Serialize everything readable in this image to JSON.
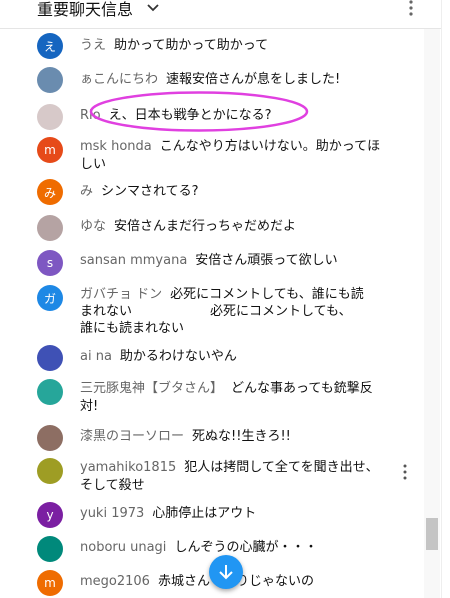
{
  "header": {
    "title": "重要聊天信息",
    "menu_icon": "chevron-down-icon",
    "more_icon": "more-vert-icon"
  },
  "colors": {
    "accent": "#2196f3",
    "annotation": "#e040e0"
  },
  "messages": [
    {
      "author": "うえ",
      "text": "助かって助かって助かって",
      "avatar": {
        "letter": "え",
        "color": "#1565c0"
      }
    },
    {
      "author": "ぁこんにちわ",
      "text": "速報安倍さんが息をしました!",
      "avatar": {
        "letter": "",
        "color": "#6a8caf"
      }
    },
    {
      "author": "Rio",
      "text": "え、日本も戦争とかになる?",
      "avatar": {
        "letter": "",
        "color": "#d7c9c9"
      }
    },
    {
      "author": "msk honda",
      "text": "こんなやり方はいけない。助かってほしい",
      "line1": "こんなやり方はいけない。助かってほ",
      "line2": "しい",
      "avatar": {
        "letter": "m",
        "color": "#e64a19"
      }
    },
    {
      "author": "み",
      "text": "シンマされてる?",
      "avatar": {
        "letter": "み",
        "color": "#ef6c00"
      }
    },
    {
      "author": "ゆな",
      "text": "安倍さんまだ行っちゃだめだよ",
      "avatar": {
        "letter": "",
        "color": "#b5a3a3"
      }
    },
    {
      "author": "sansan mmyana",
      "text": "安倍さん頑張って欲しい",
      "avatar": {
        "letter": "s",
        "color": "#7e57c2"
      }
    },
    {
      "author": "ガバチョ ドン",
      "line1": "必死にコメントしても、誰にも読",
      "line2": "まれない　　　　　　必死にコメントしても、",
      "line3": "誰にも読まれない",
      "avatar": {
        "letter": "ガ",
        "color": "#1e88e5"
      }
    },
    {
      "author": "ai na",
      "text": "助かるわけないやん",
      "avatar": {
        "letter": "",
        "color": "#3f51b5"
      }
    },
    {
      "author": "三元豚鬼神【ブタさん】",
      "text": "どんな事あっても銃撃反",
      "line2": "対!",
      "avatar": {
        "letter": "",
        "color": "#26a69a"
      }
    },
    {
      "author": "漆黒のヨーソロー",
      "text": "死ぬな!!生きろ!!",
      "avatar": {
        "letter": "",
        "color": "#8d6e63"
      }
    },
    {
      "author": "yamahiko1815",
      "text": "犯人は拷問して全てを聞き出せ、",
      "line2": "そして殺せ",
      "avatar": {
        "letter": "",
        "color": "#9e9d24"
      }
    },
    {
      "author": "yuki 1973",
      "text": "心肺停止はアウト",
      "avatar": {
        "letter": "y",
        "color": "#7b1fa2"
      }
    },
    {
      "author": "noboru unagi",
      "text": "しんぞうの心臓が・・・",
      "avatar": {
        "letter": "",
        "color": "#00897b"
      }
    },
    {
      "author": "mego2106",
      "text": "赤城さん　たりじゃないの",
      "avatar": {
        "letter": "m",
        "color": "#ef6c00"
      }
    }
  ],
  "scroll_button": {
    "icon": "arrow-down-icon"
  }
}
